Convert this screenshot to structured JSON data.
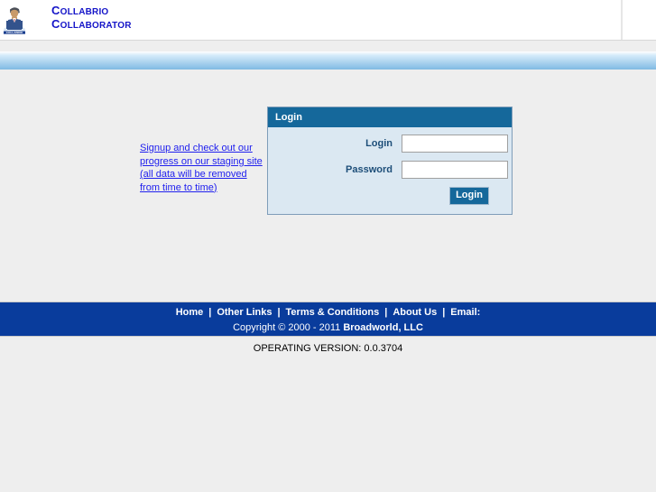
{
  "header": {
    "logo_icon": "person-logo-icon",
    "cc_mark_icon": "cc-monogram-icon",
    "brand_line1_cap": "C",
    "brand_line1_rest": "OLLABRIO",
    "brand_line2_cap": "C",
    "brand_line2_rest": "OLLABORATOR",
    "brand_color": "#1414c8",
    "cc_mark_color": "#ee0000"
  },
  "content": {
    "signup_note": "Signup and check out our progress on our staging site (all data will be removed from time to time)"
  },
  "login_panel": {
    "title": "Login",
    "header_color": "#15689b",
    "body_color": "#dbe8f2",
    "login_label": "Login",
    "login_value": "",
    "login_placeholder": "",
    "password_label": "Password",
    "password_value": "",
    "password_placeholder": "",
    "submit_label": "Login"
  },
  "footer": {
    "links": [
      {
        "label": "Home"
      },
      {
        "label": "Other Links"
      },
      {
        "label": "Terms & Conditions"
      },
      {
        "label": "About Us"
      },
      {
        "label": "Email:"
      }
    ],
    "separator": "|",
    "copyright_prefix": "Copyright © 2000 - 2011 ",
    "copyright_company": "Broadworld, LLC",
    "bar_color": "#093c9c",
    "version_text": "OPERATING VERSION: 0.0.3704"
  }
}
